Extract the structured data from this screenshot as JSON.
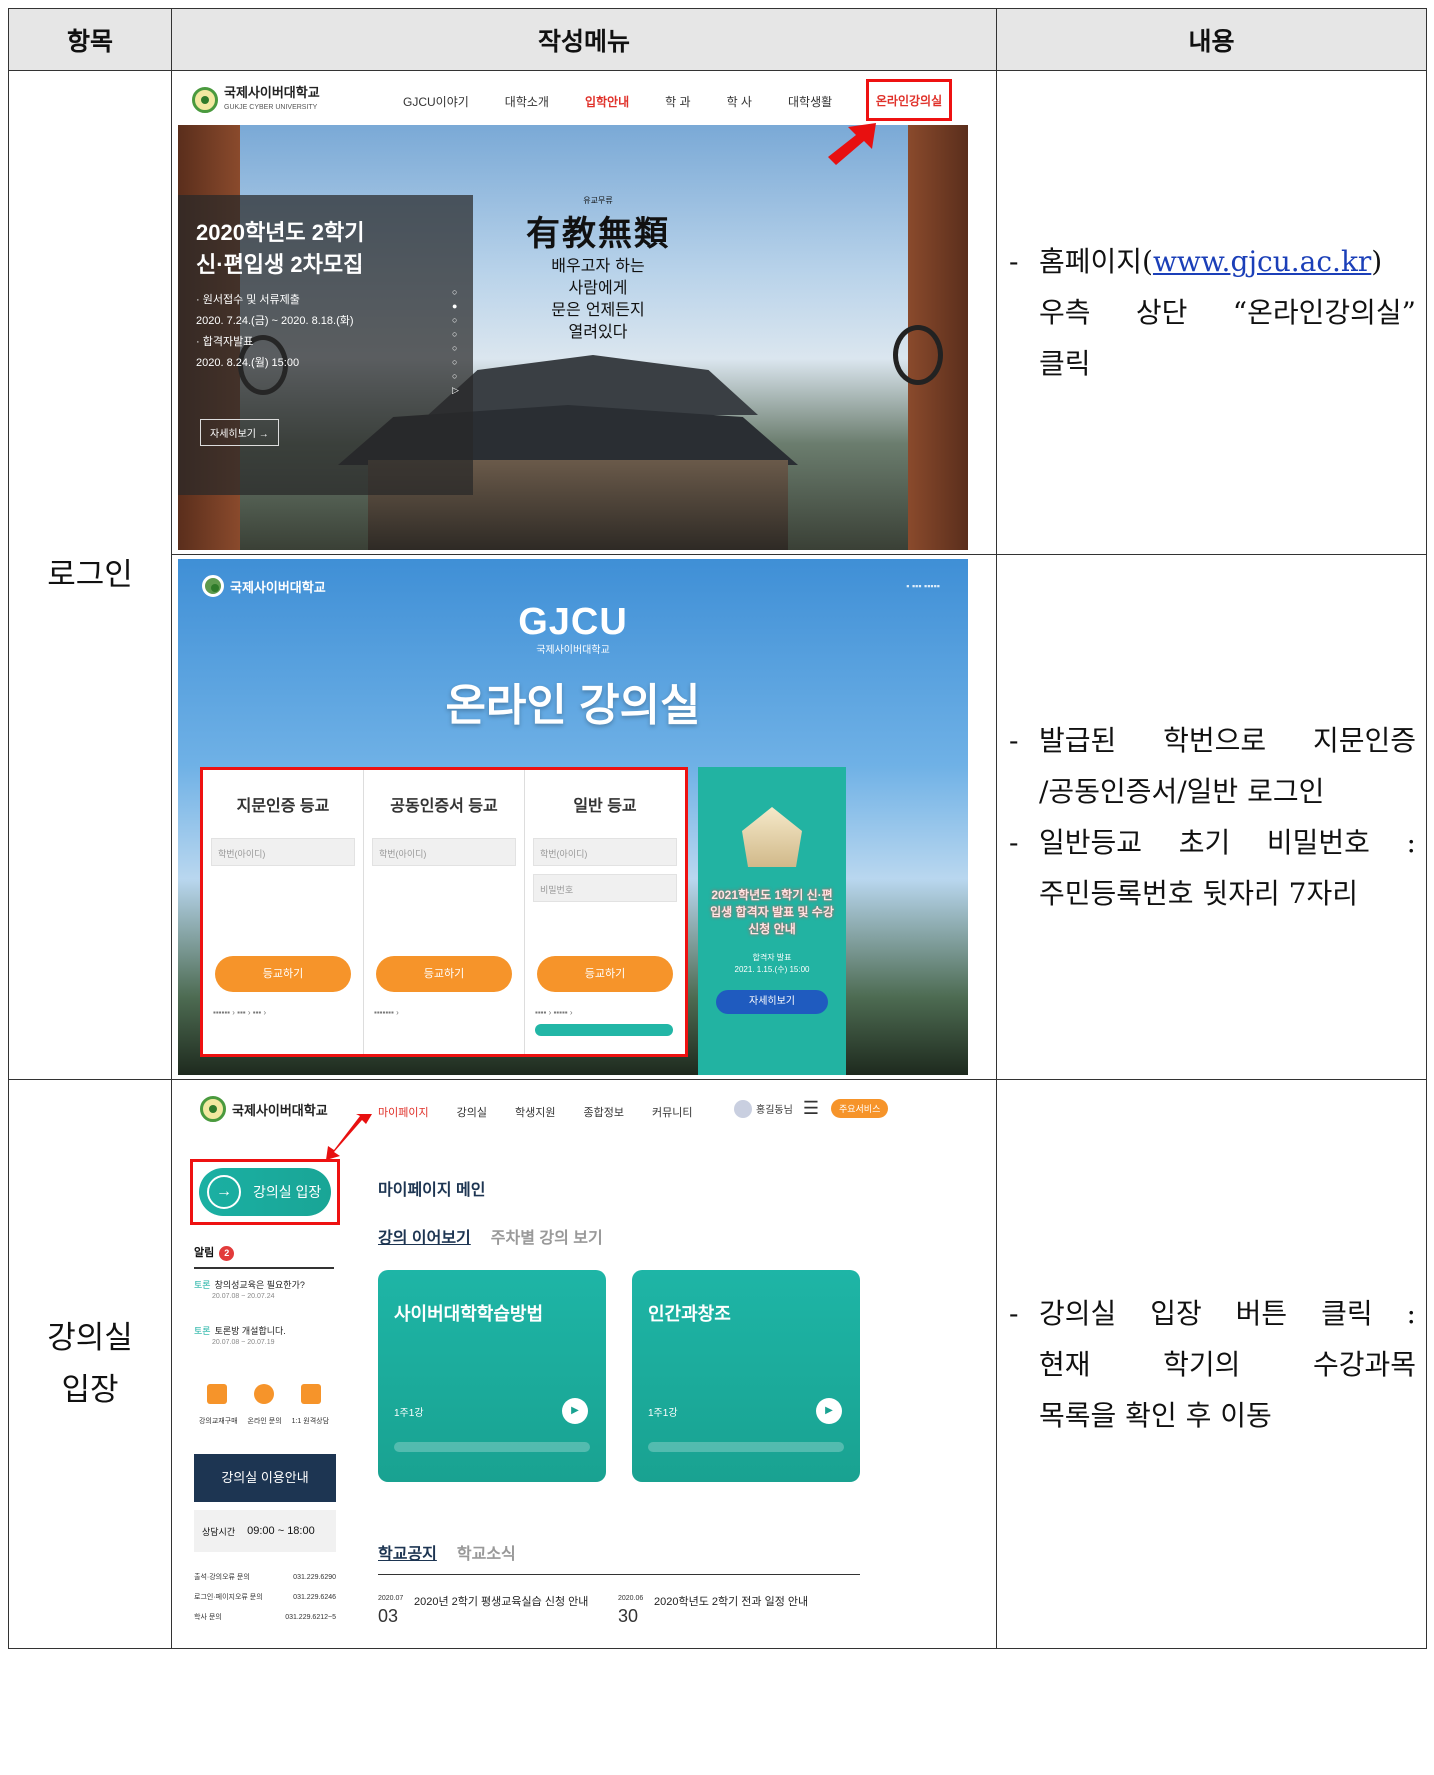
{
  "table": {
    "headers": [
      "항목",
      "작성메뉴",
      "내용"
    ],
    "rows": [
      {
        "category": "로그인",
        "desc1": {
          "pre": "홈페이지(",
          "link": "www.gjcu.ac.kr",
          "post": ")",
          "line2": "우측 상단 “온라인강의실”",
          "line3": "클릭"
        },
        "desc2": {
          "a1": "발급된 학번으로 지문인증",
          "a2": "/공동인증서/일반 로그인",
          "b1": "일반등교 초기 비밀번호 :",
          "b2": "주민등록번호 뒷자리 7자리"
        }
      },
      {
        "category_line1": "강의실",
        "category_line2": "입장",
        "desc": {
          "l1": "강의실 입장 버튼 클릭 :",
          "l2": "현재 학기의 수강과목",
          "l3": "목록을 확인 후 이동"
        }
      }
    ]
  },
  "shot1": {
    "logo_name": "국제사이버대학교",
    "logo_en": "GUKJE CYBER UNIVERSITY",
    "menu": [
      "GJCU이야기",
      "대학소개",
      "입학안내",
      "학 과",
      "학 사",
      "대학생활"
    ],
    "highlight_menu": "온라인강의실",
    "banner_title1": "2020학년도 2학기",
    "banner_title2": "신·편입생 2차모집",
    "banner_l1": "· 원서접수 및 서류제출",
    "banner_l2": "2020. 7.24.(금) ~ 2020. 8.18.(화)",
    "banner_l3": "· 합격자발표",
    "banner_l4": "2020. 8.24.(월) 15:00",
    "more_btn": "자세히보기 →",
    "callig_small": "유교무류",
    "callig_big": "有教無類",
    "callig_l1": "배우고자 하는",
    "callig_l2": "사람에게",
    "callig_l3": "문은 언제든지",
    "callig_l4": "열려있다"
  },
  "shot2": {
    "header_logo": "국제사이버대학교",
    "brand": "GJCU",
    "brand_sub": "국제사이버대학교",
    "title": "온라인 강의실",
    "col1": {
      "title": "지문인증 등교",
      "f1": "학번(아이디)",
      "btn": "등교하기"
    },
    "col2": {
      "title": "공동인증서 등교",
      "f1": "학번(아이디)",
      "btn": "등교하기"
    },
    "col3": {
      "title": "일반 등교",
      "f1": "학번(아이디)",
      "f2": "비밀번호",
      "btn": "등교하기"
    },
    "promo_title": "2021학년도 1학기 신·편입생 합격자 발표 및 수강신청 안내",
    "promo_date1": "합격자 발표",
    "promo_date2": "2021. 1.15.(수) 15:00",
    "promo_btn": "자세히보기"
  },
  "shot3": {
    "logo_name": "국제사이버대학교",
    "menu": [
      "마이페이지",
      "강의실",
      "학생지원",
      "종합정보",
      "커뮤니티"
    ],
    "user": "홍길동님",
    "service_btn": "주요서비스",
    "entry_btn": "강의실 입장",
    "alarm": "알림",
    "alarm_count": "2",
    "notice1_tag": "토론",
    "notice1": "창의성교육은 필요한가?",
    "notice1_date": "20.07.08 ~ 20.07.24",
    "notice2_tag": "토론",
    "notice2": "토론방 개설합니다.",
    "notice2_date": "20.07.08 ~ 20.07.19",
    "icon_labels": [
      "강의교재구매",
      "온라인 문의",
      "1:1 원격상담"
    ],
    "guide_btn": "강의실 이용안내",
    "hours_label": "상담시간",
    "hours": "09:00 ~ 18:00",
    "contacts": [
      {
        "label": "출석·강의오류 문의",
        "tel": "031.229.6290"
      },
      {
        "label": "로그인·페이지오류 문의",
        "tel": "031.229.6246"
      },
      {
        "label": "학사 문의",
        "tel": "031.229.6212~5"
      }
    ],
    "page_title": "마이페이지 메인",
    "tab_active": "강의 이어보기",
    "tab_other": "주차별 강의 보기",
    "courses": [
      {
        "name": "사이버대학학습방법",
        "week": "1주1강"
      },
      {
        "name": "인간과창조",
        "week": "1주1강"
      }
    ],
    "ntab_active": "학교공지",
    "ntab_other": "학교소식",
    "news": [
      {
        "ym": "2020.07",
        "d": "03",
        "title": "2020년 2학기 평생교육실습 신청 안내"
      },
      {
        "ym": "2020.06",
        "d": "30",
        "title": "2020학년도 2학기 전과 일정 안내"
      }
    ]
  }
}
